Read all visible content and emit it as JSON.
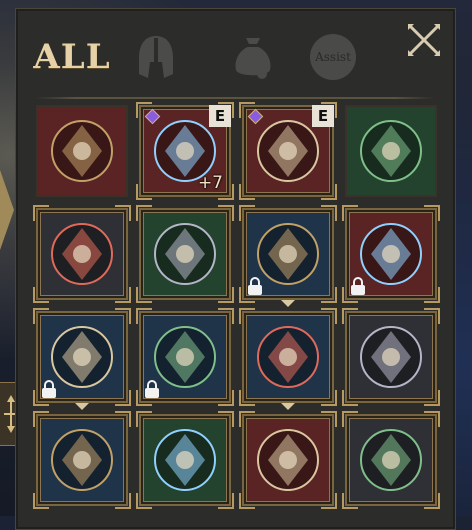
{
  "tabs": {
    "all_label": "ALL",
    "helmet_icon": "helmet-icon",
    "bag_icon": "bag-icon",
    "assist_label": "Assist",
    "close_icon": "close-icon"
  },
  "colors": {
    "gold": "#b79a62",
    "red_slot": "#5a2424",
    "green_slot": "#24432e",
    "blue_slot": "#1f3449",
    "gray_slot": "#2f3036",
    "gold_slot": "#4a3c24",
    "panel": "#2c2c2b"
  },
  "items": [
    {
      "name": "tome-icon",
      "rarity": "red",
      "plain": true
    },
    {
      "name": "ram-demon-mask-icon",
      "rarity": "red",
      "badge": "E",
      "gem": true,
      "upgrade": "+7"
    },
    {
      "name": "twin-skull-icon",
      "rarity": "red",
      "badge": "E",
      "gem": true
    },
    {
      "name": "crystal-orb-book-icon",
      "rarity": "green",
      "plain": true
    },
    {
      "name": "winged-shield-crest-icon",
      "rarity": "gray"
    },
    {
      "name": "goddess-statue-icon",
      "rarity": "green"
    },
    {
      "name": "goat-skull-crest-icon",
      "rarity": "blue",
      "locked": true,
      "tick": true
    },
    {
      "name": "horned-crimson-mask-icon",
      "rarity": "red",
      "locked": true
    },
    {
      "name": "dragon-helm-icon",
      "rarity": "blue",
      "locked": true,
      "tick": true
    },
    {
      "name": "azure-beast-emblem-icon",
      "rarity": "blue",
      "locked": true
    },
    {
      "name": "frost-star-icon",
      "rarity": "blue",
      "tick": true
    },
    {
      "name": "shadow-beast-icon",
      "rarity": "gray"
    },
    {
      "name": "hooded-specter-orb-icon",
      "rarity": "blue"
    },
    {
      "name": "diamond-rune-icon",
      "rarity": "green"
    },
    {
      "name": "pocket-watch-icon",
      "rarity": "red"
    },
    {
      "name": "dark-cross-sigil-icon",
      "rarity": "gray"
    }
  ]
}
